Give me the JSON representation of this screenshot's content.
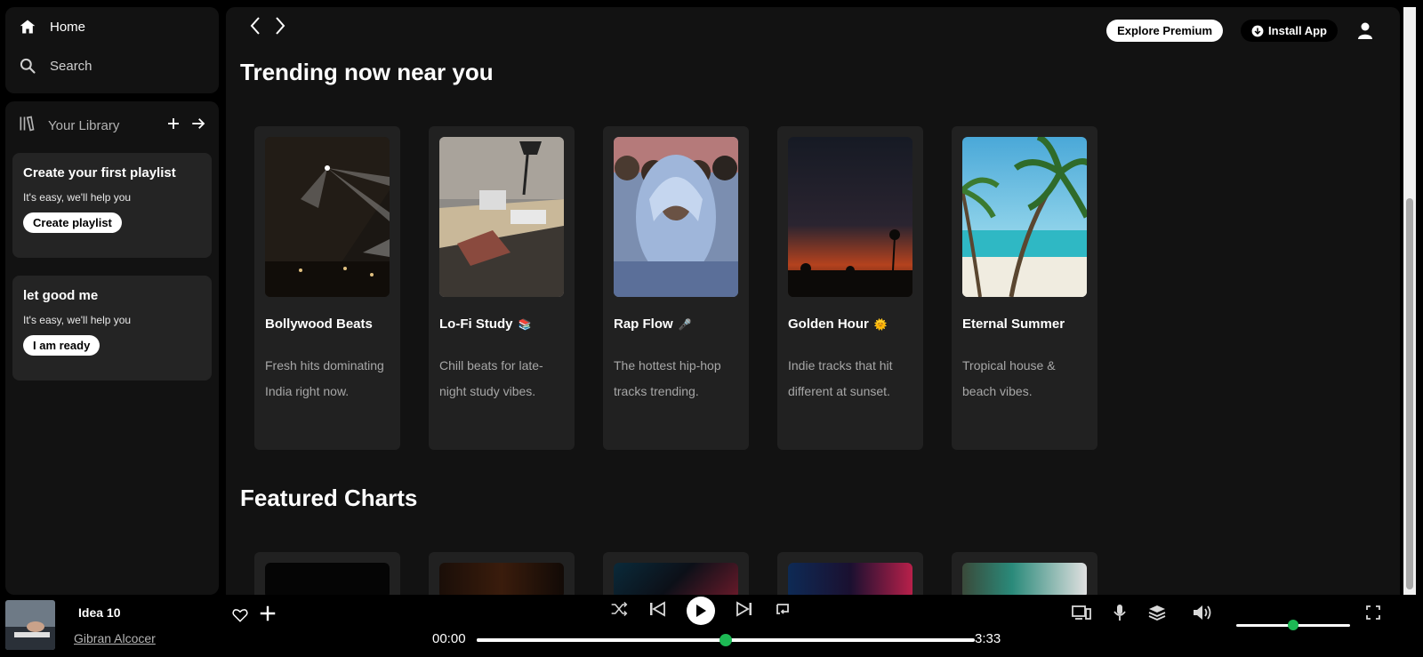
{
  "nav": {
    "home_label": "Home",
    "search_label": "Search"
  },
  "library": {
    "title": "Your Library",
    "cards": [
      {
        "title": "Create your first playlist",
        "subtitle": "It's easy, we'll help you",
        "button": "Create playlist"
      },
      {
        "title": "let good me",
        "subtitle": "It's easy, we'll help you",
        "button": "I am ready"
      }
    ]
  },
  "topbar": {
    "premium_label": "Explore Premium",
    "install_label": "Install App"
  },
  "sections": [
    {
      "title": "Trending now near you",
      "cards": [
        {
          "title": "Bollywood Beats",
          "emoji": "",
          "desc": "Fresh hits dominating India right now.",
          "art": "concert"
        },
        {
          "title": "Lo-Fi Study",
          "emoji": "📚",
          "desc": "Chill beats for late-night study vibes.",
          "art": "desk"
        },
        {
          "title": "Rap Flow",
          "emoji": "🎤",
          "desc": "The hottest hip-hop tracks trending.",
          "art": "hoodie"
        },
        {
          "title": "Golden Hour",
          "emoji": "🌞",
          "desc": "Indie tracks that hit different at sunset.",
          "art": "sunset"
        },
        {
          "title": "Eternal Summer",
          "emoji": "",
          "desc": "Tropical house & beach vibes.",
          "art": "beach"
        }
      ]
    },
    {
      "title": "Featured Charts"
    }
  ],
  "player": {
    "track_title": "Idea 10",
    "artist": "Gibran Alcocer",
    "time_elapsed": "00:00",
    "time_total": "3:33",
    "progress": 0.5,
    "volume": 0.5,
    "accent_color": "#1db954"
  }
}
